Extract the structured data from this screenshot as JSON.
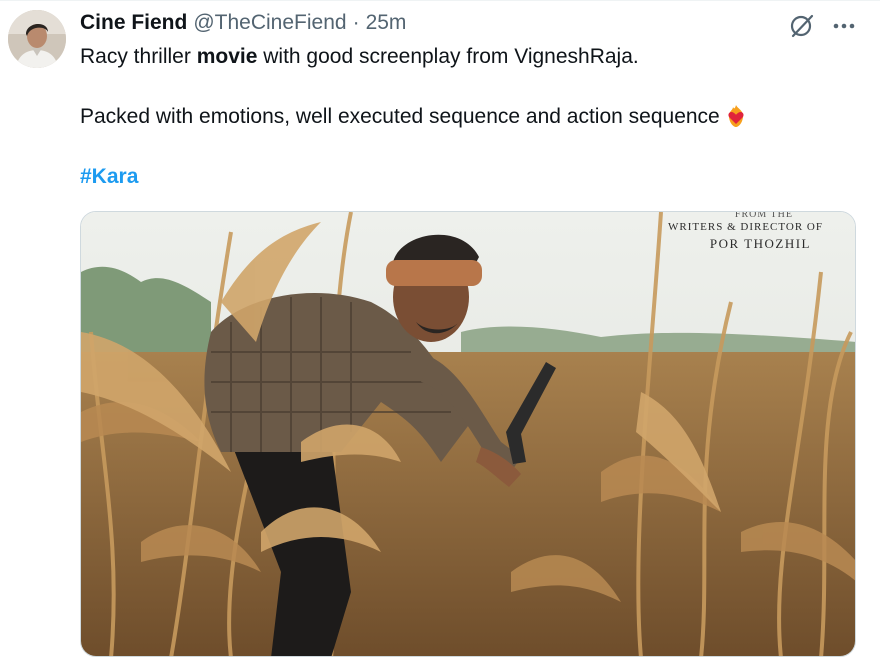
{
  "tweet": {
    "author": {
      "display_name": "Cine Fiend",
      "handle": "@TheCineFiend",
      "separator": "·",
      "time": "25m"
    },
    "text": {
      "line1_before": "Racy thriller ",
      "line1_bold": "movie",
      "line1_after": " with good screenplay from VigneshRaja.",
      "line2": "Packed with emotions, well executed sequence and action sequence",
      "line2_emoji": "heart-on-fire-emoji"
    },
    "hashtag": "#Kara",
    "media": {
      "poster_line_small": "FROM THE",
      "poster_line_mid": "WRITERS & DIRECTOR OF",
      "poster_line_big": "POR THOZHIL"
    },
    "icons": {
      "grok": "grok-icon",
      "more": "more-icon"
    },
    "colors": {
      "link": "#1d9bf0",
      "text": "#0f1419",
      "secondary": "#536471"
    }
  }
}
